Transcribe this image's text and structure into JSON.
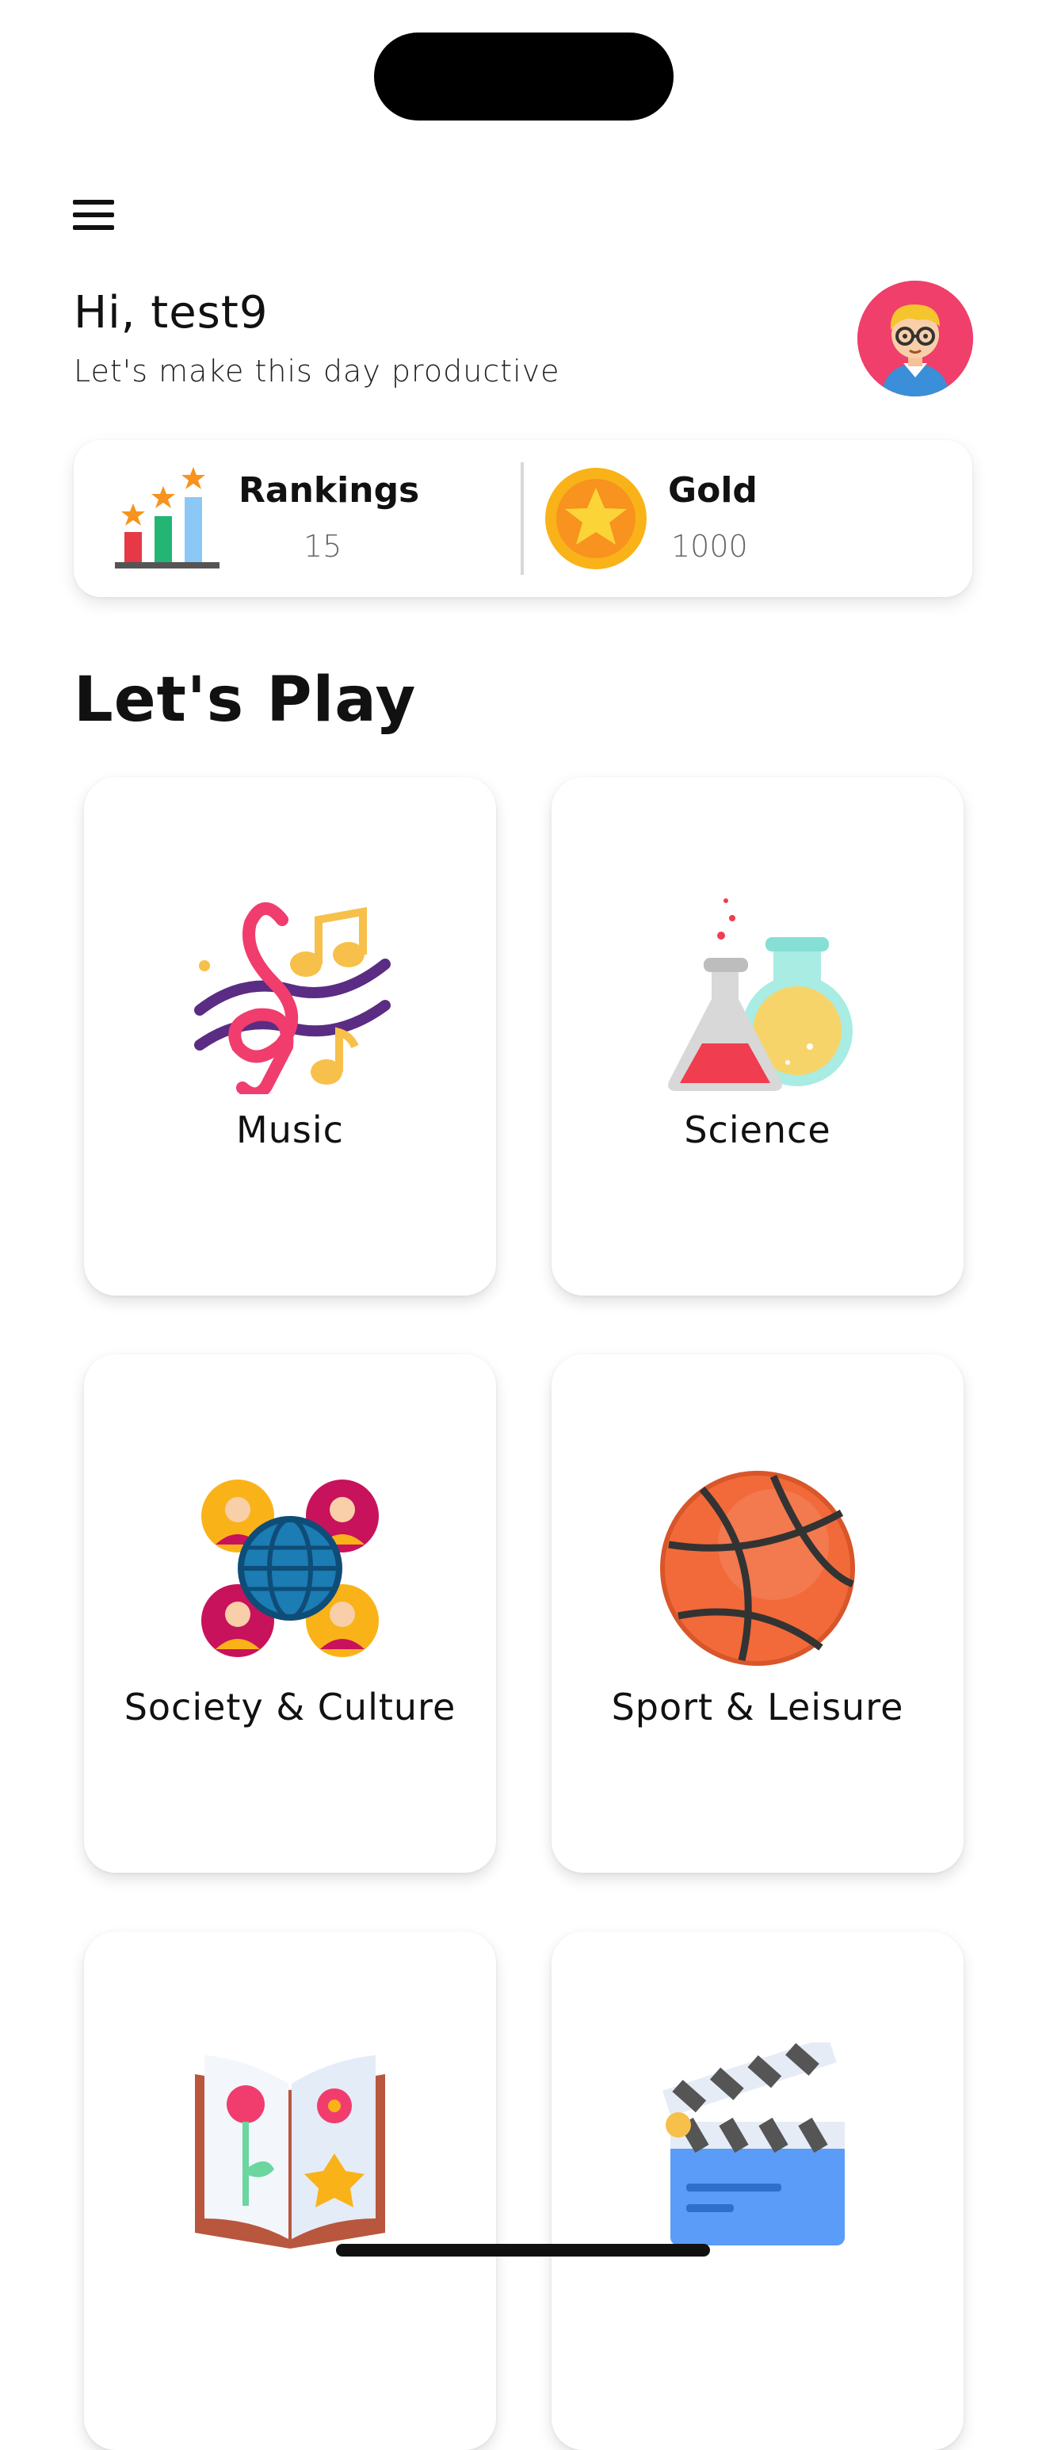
{
  "header": {
    "menu_icon": "hamburger-menu-icon",
    "greeting": "Hi, test9",
    "subtitle": "Let's make this day productive",
    "avatar_icon": "boy-with-glasses-avatar"
  },
  "stats": {
    "rankings": {
      "label": "Rankings",
      "value": "15",
      "icon": "ranking-bars-icon"
    },
    "gold": {
      "label": "Gold",
      "value": "1000",
      "icon": "gold-coin-icon"
    }
  },
  "section_title": "Let's Play",
  "categories": [
    {
      "label": "Music",
      "icon": "music-notes-icon"
    },
    {
      "label": "Science",
      "icon": "science-flasks-icon"
    },
    {
      "label": "Society & Culture",
      "icon": "globe-people-icon"
    },
    {
      "label": "Sport & Leisure",
      "icon": "basketball-icon"
    },
    {
      "label": "",
      "icon": "open-book-icon"
    },
    {
      "label": "",
      "icon": "clapperboard-icon"
    }
  ],
  "colors": {
    "background": "#ffffff",
    "avatar_bg": "#ef3f6a",
    "gold": "#f9b319",
    "text": "#111111"
  }
}
